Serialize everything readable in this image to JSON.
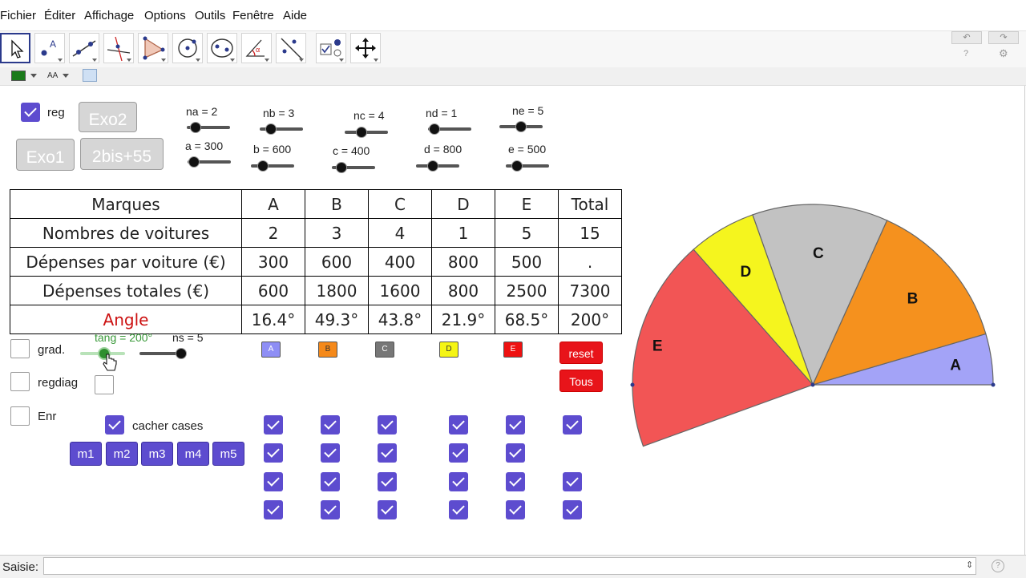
{
  "menu": [
    "Fichier",
    "Éditer",
    "Affichage",
    "Options",
    "Outils",
    "Fenêtre",
    "Aide"
  ],
  "toolbar": {
    "tools": [
      "move-tool",
      "point-tool",
      "line-tool",
      "perpendicular-line-tool",
      "polygon-tool",
      "circle-tool",
      "ellipse-tool",
      "angle-tool",
      "reflect-tool",
      "slider-tool",
      "move-graphics-tool"
    ],
    "undo_label": "↶",
    "redo_label": "↷",
    "help_label": "?",
    "settings_label": "⚙"
  },
  "stylebar": {
    "color": "#1a7a1a",
    "text_size_label": "AA"
  },
  "controls": {
    "reg_label": "reg",
    "exo2": "Exo2",
    "exo1": "Exo1",
    "bis": "2bis+55",
    "grad_label": "grad.",
    "regdiag_label": "regdiag",
    "enr_label": "Enr",
    "cacher_label": "cacher cases",
    "tang_label": "tang = 200°",
    "ns_label": "ns = 5",
    "reset": "reset",
    "tous": "Tous",
    "m_buttons": [
      "m1",
      "m2",
      "m3",
      "m4",
      "m5"
    ]
  },
  "sliders": [
    {
      "label": "na = 2",
      "value": 2
    },
    {
      "label": "nb = 3",
      "value": 3
    },
    {
      "label": "nc = 4",
      "value": 4
    },
    {
      "label": "nd = 1",
      "value": 1
    },
    {
      "label": "ne = 5",
      "value": 5
    },
    {
      "label": "a = 300",
      "value": 300
    },
    {
      "label": "b = 600",
      "value": 600
    },
    {
      "label": "c = 400",
      "value": 400
    },
    {
      "label": "d = 800",
      "value": 800
    },
    {
      "label": "e = 500",
      "value": 500
    }
  ],
  "table": {
    "rows": [
      [
        "Marques",
        "A",
        "B",
        "C",
        "D",
        "E",
        "Total"
      ],
      [
        "Nombres de voitures",
        "2",
        "3",
        "4",
        "1",
        "5",
        "15"
      ],
      [
        "Dépenses par voiture (€)",
        "300",
        "600",
        "400",
        "800",
        "500",
        "."
      ],
      [
        "Dépenses totales (€)",
        "600",
        "1800",
        "1600",
        "800",
        "2500",
        "7300"
      ],
      [
        "Angle",
        "16.4°",
        "49.3°",
        "43.8°",
        "21.9°",
        "68.5°",
        "200°"
      ]
    ],
    "angle_color": "#cc1111"
  },
  "legend_buttons": [
    {
      "label": "A",
      "color": "#8e8ef5"
    },
    {
      "label": "B",
      "color": "#f5891a"
    },
    {
      "label": "C",
      "color": "#777777"
    },
    {
      "label": "D",
      "color": "#f5f514"
    },
    {
      "label": "E",
      "color": "#ee1111"
    }
  ],
  "chart_data": {
    "type": "pie",
    "categories": [
      "A",
      "B",
      "C",
      "D",
      "E"
    ],
    "values": [
      16.4,
      49.3,
      43.8,
      21.9,
      68.5
    ],
    "total_angle": 200,
    "colors": [
      "#a3a3f7",
      "#f5911e",
      "#c2c2c2",
      "#f5f51e",
      "#f25555"
    ]
  },
  "input_bar": {
    "label": "Saisie:",
    "value": ""
  }
}
